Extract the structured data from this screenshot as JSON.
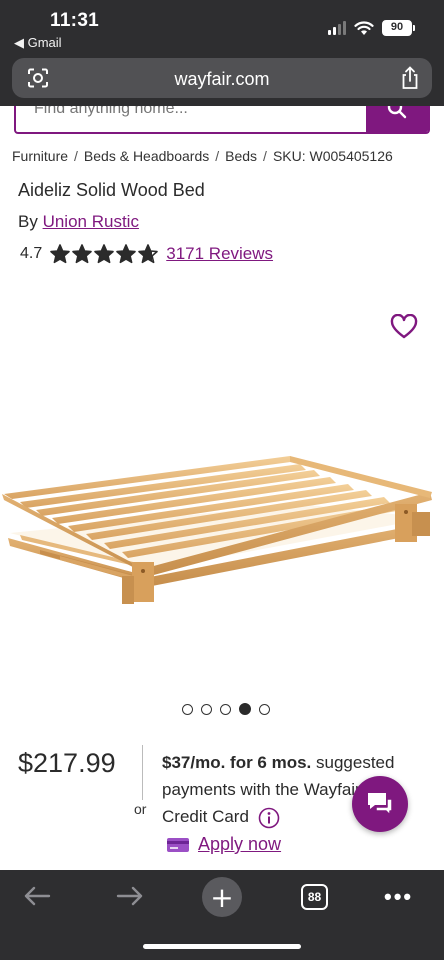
{
  "status_bar": {
    "time": "11:31",
    "back_app": "◀ Gmail",
    "battery": "90"
  },
  "browser": {
    "url": "wayfair.com"
  },
  "search": {
    "placeholder": "Find anything home..."
  },
  "breadcrumb": [
    {
      "label": "Furniture"
    },
    {
      "label": "Beds & Headboards"
    },
    {
      "label": "Beds"
    },
    {
      "label": "SKU: W005405126"
    }
  ],
  "breadcrumb_separator": "/",
  "product": {
    "title": "Aideliz Solid Wood Bed",
    "by_prefix": "By",
    "brand": "Union Rustic",
    "rating": "4.7",
    "rating_value": 4.7,
    "rating_max": 5,
    "reviews": "3171 Reviews",
    "image_count": 5,
    "active_image_index": 3
  },
  "pricing": {
    "price": "$217.99",
    "or_label": "or",
    "monthly": "$37/mo. for 6 mos.",
    "finance_text_1": " suggested payments with the Wayfair",
    "finance_text_2": "Credit Card",
    "apply_label": "Apply now"
  },
  "bottom_toolbar": {
    "tab_count": "88",
    "new_tab_symbol": "+",
    "more_symbol": "•••"
  },
  "colors": {
    "brand": "#7f187f",
    "chrome": "#2e2e30",
    "url_bar": "#515154"
  },
  "icons": [
    "chevron-left-icon",
    "signal-icon",
    "wifi-icon",
    "battery-icon",
    "reader-icon",
    "share-icon",
    "search-icon",
    "star-icon",
    "heart-icon",
    "info-icon",
    "credit-card-icon",
    "chat-icon",
    "back-arrow-icon",
    "forward-arrow-icon",
    "plus-icon",
    "tabs-icon",
    "more-icon"
  ]
}
